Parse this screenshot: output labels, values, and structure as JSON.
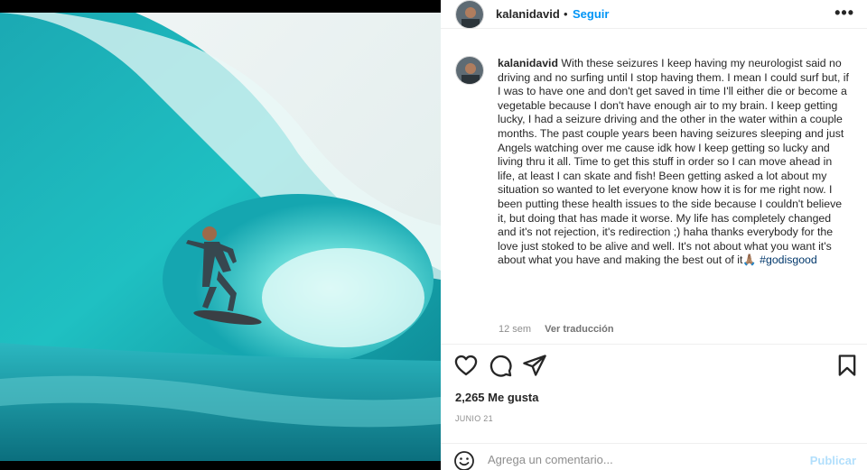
{
  "photo": {
    "alt_subject": "surfer-in-barrel-wave"
  },
  "header": {
    "username": "kalanidavid",
    "separator": "•",
    "follow_label": "Seguir",
    "more_label": "•••"
  },
  "caption": {
    "username": "kalanidavid",
    "text": "With these seizures I keep having my neurologist said no driving and no surfing until I stop having them. I mean I could surf but, if I was to have one and don't get saved in time I'll either die or become a vegetable because I don't have enough air to my brain. I keep getting lucky, I had a seizure driving and the other in the water within a couple months. The past couple years been having seizures sleeping and just Angels watching over me cause idk how I keep getting so lucky and living thru it all. Time to get this stuff in order so I can move ahead in life, at least I can skate and fish! Been getting asked a lot about my situation so wanted to let everyone know how it is for me right now. I been putting these health issues to the side because I couldn't believe it, but doing that has made it worse. My life has completely changed and it's not rejection, it's redirection ;) haha thanks everybody for the love just stoked to be alive and well. It's not about what you want it's about what you have and making the best out of it",
    "emoji": "🙏🏽",
    "hashtag": "#godisgood",
    "age": "12 sem",
    "translate_label": "Ver traducción"
  },
  "actions": {
    "like_icon": "heart-icon",
    "comment_icon": "comment-icon",
    "share_icon": "paper-plane-icon",
    "save_icon": "bookmark-icon"
  },
  "likes_text": "2,265 Me gusta",
  "date_text": "JUNIO 21",
  "add_comment": {
    "placeholder": "Agrega un comentario...",
    "post_label": "Publicar"
  },
  "colors": {
    "accent": "#0095f6",
    "link": "#00376b",
    "muted": "#8e8e8e",
    "post_disabled": "#b2dffc"
  }
}
